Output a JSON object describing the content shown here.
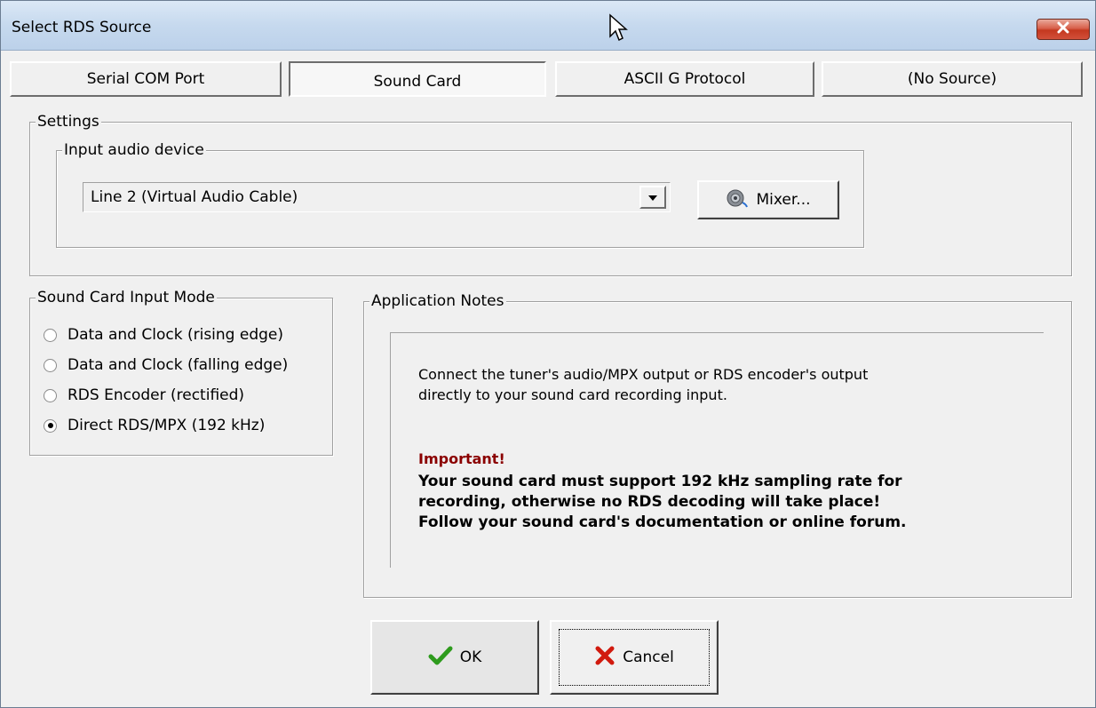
{
  "window": {
    "title": "Select RDS Source"
  },
  "tabs": [
    {
      "label": "Serial COM Port"
    },
    {
      "label": "Sound Card"
    },
    {
      "label": "ASCII G Protocol"
    },
    {
      "label": "(No Source)"
    }
  ],
  "settings": {
    "legend": "Settings",
    "input_audio": {
      "legend": "Input audio device",
      "selected_device": "Line 2 (Virtual Audio Cable)",
      "mixer_label": "Mixer..."
    }
  },
  "input_mode": {
    "legend": "Sound Card Input Mode",
    "options": [
      {
        "label": "Data and Clock (rising edge)",
        "checked": false
      },
      {
        "label": "Data and Clock (falling edge)",
        "checked": false
      },
      {
        "label": "RDS Encoder (rectified)",
        "checked": false
      },
      {
        "label": "Direct RDS/MPX (192 kHz)",
        "checked": true
      }
    ]
  },
  "notes": {
    "legend": "Application Notes",
    "line1": "Connect the tuner's audio/MPX output or RDS encoder's output",
    "line2": "directly to your sound card recording input.",
    "important_head": "Important!",
    "important_line1": "Your sound card must support 192 kHz sampling rate for",
    "important_line2": "recording, otherwise no RDS decoding will take place!",
    "important_line3": "Follow your sound card's documentation or online forum."
  },
  "buttons": {
    "ok_label": "OK",
    "cancel_label": "Cancel"
  },
  "icons": {
    "close": "close-icon",
    "mixer": "speaker-icon",
    "ok": "checkmark-icon",
    "cancel": "red-x-icon",
    "cursor": "mouse-pointer-icon"
  },
  "colors": {
    "important": "#8b0000",
    "close_button": "#c4381f",
    "checkmark": "#2e9b1d",
    "cancel_x": "#d11a0e"
  }
}
